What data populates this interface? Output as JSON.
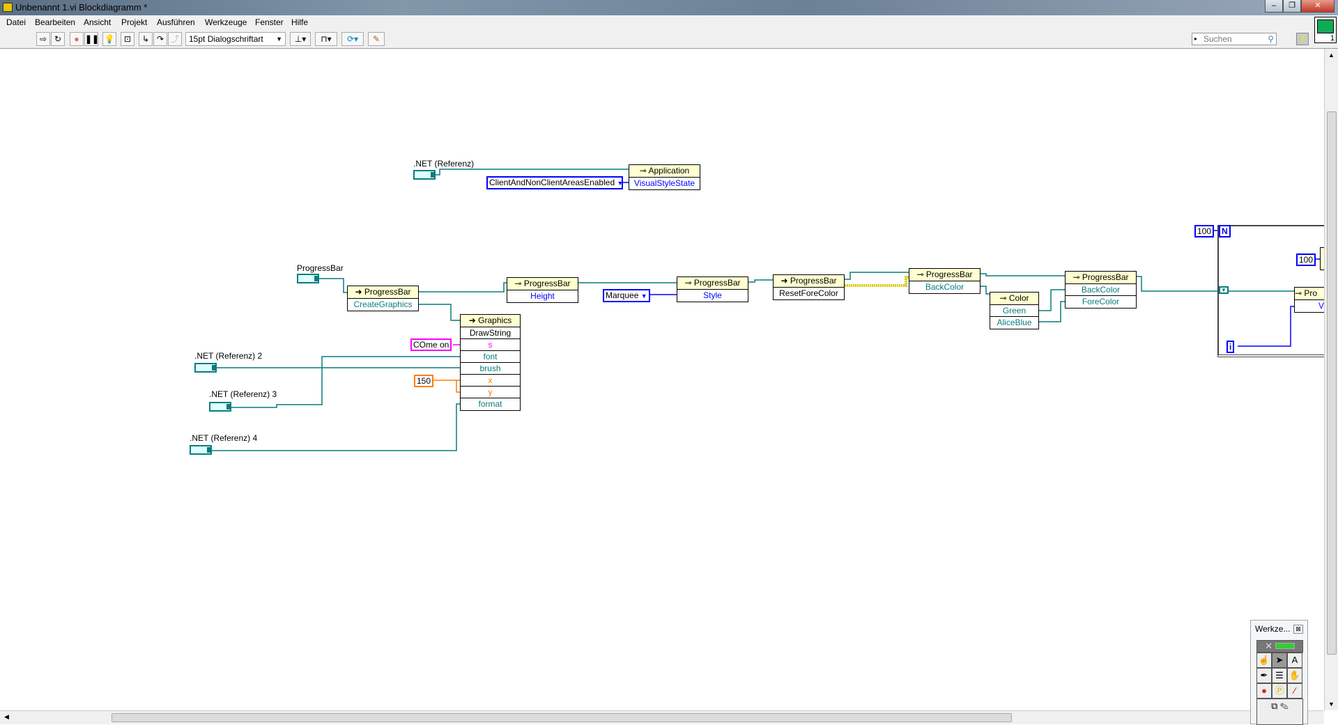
{
  "window": {
    "title": "Unbenannt 1.vi Blockdiagramm *",
    "minimize": "‒",
    "restore": "❐",
    "close": "✕"
  },
  "menu": [
    "Datei",
    "Bearbeiten",
    "Ansicht",
    "Projekt",
    "Ausführen",
    "Werkzeuge",
    "Fenster",
    "Hilfe"
  ],
  "toolbar": {
    "font": "15pt Dialogschriftart",
    "search_placeholder": "Suchen",
    "help": "?",
    "vi_icon_number": "1"
  },
  "diagram": {
    "net_ref_1": ".NET (Referenz)",
    "net_ref_2": ".NET (Referenz) 2",
    "net_ref_3": ".NET (Referenz) 3",
    "net_ref_4": ".NET (Referenz) 4",
    "progressbar_label": "ProgressBar",
    "application_node": {
      "class": "Application",
      "prop": "VisualStyleState"
    },
    "enum_visual": "ClientAndNonClientAreasEnabled",
    "create_graphics": {
      "class": "ProgressBar",
      "method": "CreateGraphics"
    },
    "height_node": {
      "class": "ProgressBar",
      "prop": "Height"
    },
    "enum_style": "Marquee",
    "style_node": {
      "class": "ProgressBar",
      "prop": "Style"
    },
    "reset_node": {
      "class": "ProgressBar",
      "method": "ResetForeColor"
    },
    "backcolor_node": {
      "class": "ProgressBar",
      "prop": "BackColor"
    },
    "color_node": {
      "class": "Color",
      "props": [
        "Green",
        "AliceBlue"
      ]
    },
    "colors_node": {
      "class": "ProgressBar",
      "props": [
        "BackColor",
        "ForeColor"
      ]
    },
    "drawstring": {
      "class": "Graphics",
      "method": "DrawString",
      "params": [
        "s",
        "font",
        "brush",
        "x",
        "y",
        "format"
      ]
    },
    "string_const": "COme on",
    "num_const": "150",
    "loop": {
      "count_const": "100",
      "n": "N",
      "i": "i",
      "inner_const": "100",
      "inner_node": "Pro",
      "inner_prop": "V"
    }
  },
  "palette": {
    "title": "Werkze...",
    "close": "⊠"
  },
  "colors": {
    "wire_ref": "#0a7c7c",
    "wire_enum": "#0000ff",
    "wire_string": "#ff00ff",
    "wire_number": "#ff7f00",
    "wire_error": "#e0d000",
    "node_header": "#ffffd0"
  }
}
